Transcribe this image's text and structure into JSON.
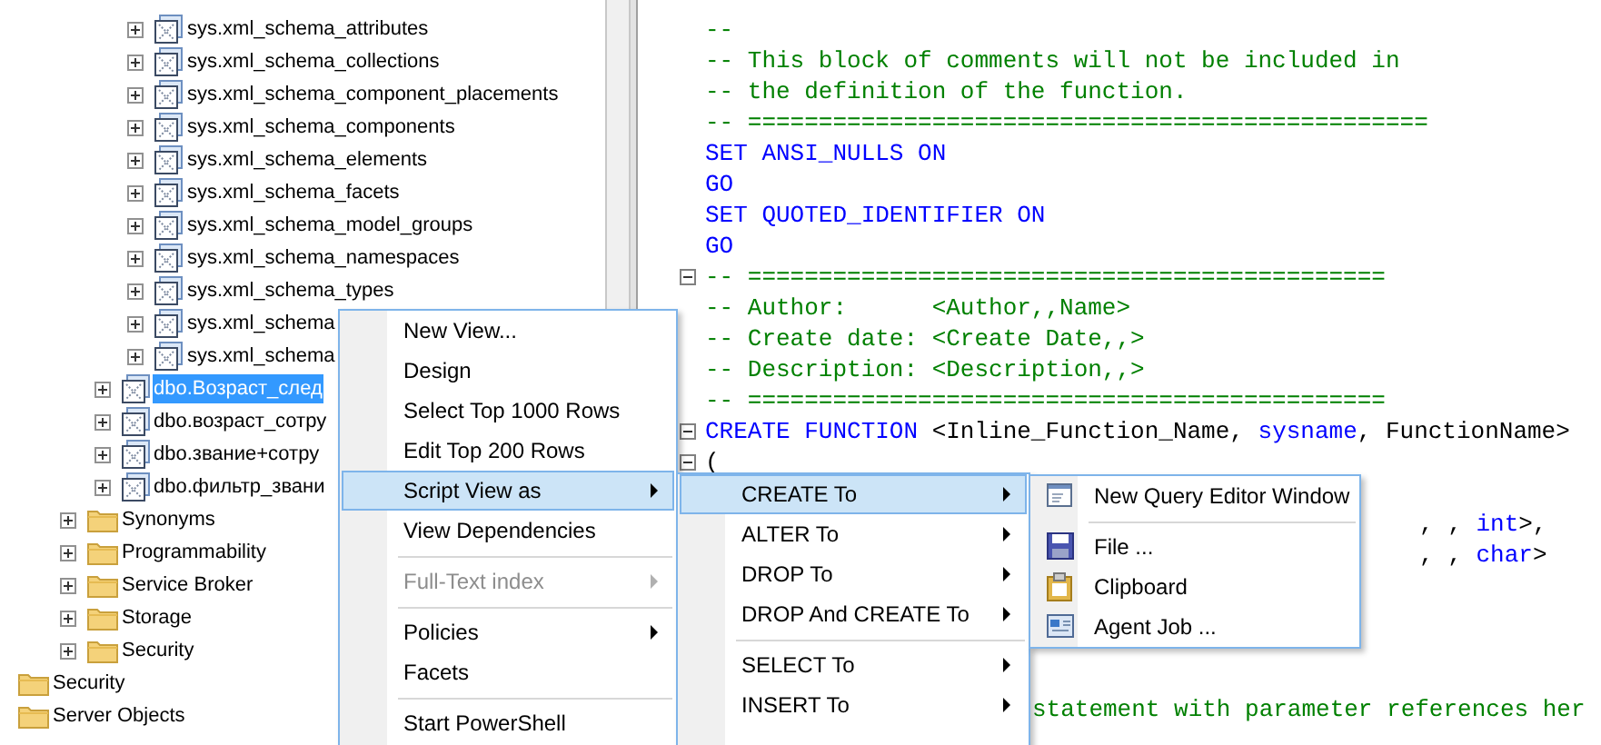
{
  "tree": [
    {
      "children": [
        {
          "children": [
            {
              "children": [
                {
                  "label": "sys.xml_schema_attributes",
                  "kind": "view",
                  "expander": true,
                  "selected": false
                },
                {
                  "label": "sys.xml_schema_collections",
                  "kind": "view",
                  "expander": true,
                  "selected": false
                },
                {
                  "label": "sys.xml_schema_component_placements",
                  "kind": "view",
                  "expander": true,
                  "selected": false
                },
                {
                  "label": "sys.xml_schema_components",
                  "kind": "view",
                  "expander": true,
                  "selected": false
                },
                {
                  "label": "sys.xml_schema_elements",
                  "kind": "view",
                  "expander": true,
                  "selected": false
                },
                {
                  "label": "sys.xml_schema_facets",
                  "kind": "view",
                  "expander": true,
                  "selected": false
                },
                {
                  "label": "sys.xml_schema_model_groups",
                  "kind": "view",
                  "expander": true,
                  "selected": false
                },
                {
                  "label": "sys.xml_schema_namespaces",
                  "kind": "view",
                  "expander": true,
                  "selected": false
                },
                {
                  "label": "sys.xml_schema_types",
                  "kind": "view",
                  "expander": true,
                  "selected": false
                },
                {
                  "label": "sys.xml_schema",
                  "kind": "view",
                  "expander": true,
                  "selected": false
                },
                {
                  "label": "sys.xml_schema",
                  "kind": "view",
                  "expander": true,
                  "selected": false
                }
              ]
            },
            {
              "label": "dbo.Возраст_след",
              "kind": "view",
              "expander": true,
              "selected": true
            },
            {
              "label": "dbo.возраст_сотру",
              "kind": "view",
              "expander": true,
              "selected": false
            },
            {
              "label": "dbo.звание+сотру",
              "kind": "view",
              "expander": true,
              "selected": false
            },
            {
              "label": "dbo.фильтр_звани",
              "kind": "view",
              "expander": true,
              "selected": false
            }
          ]
        },
        {
          "label": "Synonyms",
          "kind": "folder",
          "expander": true,
          "selected": false
        },
        {
          "label": "Programmability",
          "kind": "folder",
          "expander": true,
          "selected": false
        },
        {
          "label": "Service Broker",
          "kind": "folder",
          "expander": true,
          "selected": false
        },
        {
          "label": "Storage",
          "kind": "folder",
          "expander": true,
          "selected": false
        },
        {
          "label": "Security",
          "kind": "folder",
          "expander": true,
          "selected": false
        }
      ]
    },
    {
      "label": "Security",
      "kind": "folder",
      "expander": false,
      "selected": false
    },
    {
      "label": "Server Objects",
      "kind": "folder",
      "expander": false,
      "selected": false
    }
  ],
  "code": [
    {
      "kind": "code",
      "collapsible": false,
      "segments": [
        {
          "kind": "comment",
          "text": "--"
        }
      ]
    },
    {
      "kind": "code",
      "collapsible": false,
      "segments": [
        {
          "kind": "comment",
          "text": "-- This block of comments will not be included in"
        }
      ]
    },
    {
      "kind": "code",
      "collapsible": false,
      "segments": [
        {
          "kind": "comment",
          "text": "-- the definition of the function."
        }
      ]
    },
    {
      "kind": "code",
      "collapsible": false,
      "segments": [
        {
          "kind": "comment",
          "text": "-- ================================================"
        }
      ]
    },
    {
      "kind": "code",
      "collapsible": false,
      "segments": [
        {
          "kind": "keyword",
          "text": "SET ANSI_NULLS ON"
        }
      ]
    },
    {
      "kind": "code",
      "collapsible": false,
      "segments": [
        {
          "kind": "keyword",
          "text": "GO"
        }
      ]
    },
    {
      "kind": "code",
      "collapsible": false,
      "segments": [
        {
          "kind": "keyword",
          "text": "SET QUOTED_IDENTIFIER ON"
        }
      ]
    },
    {
      "kind": "code",
      "collapsible": false,
      "segments": [
        {
          "kind": "keyword",
          "text": "GO"
        }
      ]
    },
    {
      "kind": "code",
      "collapsible": true,
      "segments": [
        {
          "kind": "comment",
          "text": "-- ============================================="
        }
      ]
    },
    {
      "kind": "code",
      "collapsible": false,
      "segments": [
        {
          "kind": "comment",
          "text": "-- Author:      <Author,,Name>"
        }
      ]
    },
    {
      "kind": "code",
      "collapsible": false,
      "segments": [
        {
          "kind": "comment",
          "text": "-- Create date: <Create Date,,>"
        }
      ]
    },
    {
      "kind": "code",
      "collapsible": false,
      "segments": [
        {
          "kind": "comment",
          "text": "-- Description: <Description,,>"
        }
      ]
    },
    {
      "kind": "code",
      "collapsible": false,
      "segments": [
        {
          "kind": "comment",
          "text": "-- ============================================="
        }
      ]
    },
    {
      "kind": "code",
      "collapsible": true,
      "segments": [
        {
          "kind": "keyword",
          "text": "CREATE FUNCTION "
        },
        {
          "kind": "plain",
          "text": "<Inline_Function_Name, "
        },
        {
          "kind": "keyword",
          "text": "sysname"
        },
        {
          "kind": "plain",
          "text": ", FunctionName>"
        }
      ]
    },
    {
      "kind": "code",
      "collapsible": true,
      "segments": [
        {
          "kind": "plain",
          "text": "("
        }
      ]
    },
    {
      "kind": "blank"
    },
    {
      "kind": "tail",
      "collapsible": false,
      "segments": [
        {
          "kind": "plain",
          "text": ", , "
        },
        {
          "kind": "keyword",
          "text": "int"
        },
        {
          "kind": "plain",
          "text": ">,"
        }
      ]
    },
    {
      "kind": "tail",
      "collapsible": false,
      "segments": [
        {
          "kind": "plain",
          "text": ", , "
        },
        {
          "kind": "keyword",
          "text": "char"
        },
        {
          "kind": "plain",
          "text": ">"
        }
      ]
    },
    {
      "kind": "blank"
    },
    {
      "kind": "blank"
    },
    {
      "kind": "blank"
    },
    {
      "kind": "blank"
    },
    {
      "kind": "after_menu",
      "collapsible": false,
      "segments": [
        {
          "kind": "comment",
          "text": "statement with parameter references her"
        }
      ]
    }
  ],
  "context_menu": {
    "items": [
      {
        "kind": "item",
        "label": "New View...",
        "selected": false,
        "disabled": false,
        "submenu": false
      },
      {
        "kind": "item",
        "label": "Design",
        "selected": false,
        "disabled": false,
        "submenu": false
      },
      {
        "kind": "item",
        "label": "Select Top 1000 Rows",
        "selected": false,
        "disabled": false,
        "submenu": false
      },
      {
        "kind": "item",
        "label": "Edit Top 200 Rows",
        "selected": false,
        "disabled": false,
        "submenu": false
      },
      {
        "kind": "item",
        "label": "Script View as",
        "selected": true,
        "disabled": false,
        "submenu": true
      },
      {
        "kind": "item",
        "label": "View Dependencies",
        "selected": false,
        "disabled": false,
        "submenu": false
      },
      {
        "kind": "separator"
      },
      {
        "kind": "item",
        "label": "Full-Text index",
        "selected": false,
        "disabled": true,
        "submenu": true
      },
      {
        "kind": "separator"
      },
      {
        "kind": "item",
        "label": "Policies",
        "selected": false,
        "disabled": false,
        "submenu": true
      },
      {
        "kind": "item",
        "label": "Facets",
        "selected": false,
        "disabled": false,
        "submenu": false
      },
      {
        "kind": "separator"
      },
      {
        "kind": "item",
        "label": "Start PowerShell",
        "selected": false,
        "disabled": false,
        "submenu": false
      }
    ]
  },
  "script_submenu": {
    "items": [
      {
        "kind": "item",
        "label": "CREATE To",
        "selected": true,
        "disabled": false,
        "submenu": true
      },
      {
        "kind": "item",
        "label": "ALTER To",
        "selected": false,
        "disabled": false,
        "submenu": true
      },
      {
        "kind": "item",
        "label": "DROP To",
        "selected": false,
        "disabled": false,
        "submenu": true
      },
      {
        "kind": "item",
        "label": "DROP And CREATE To",
        "selected": false,
        "disabled": false,
        "submenu": true
      },
      {
        "kind": "separator"
      },
      {
        "kind": "item",
        "label": "SELECT To",
        "selected": false,
        "disabled": false,
        "submenu": true
      },
      {
        "kind": "item",
        "label": "INSERT To",
        "selected": false,
        "disabled": false,
        "submenu": true
      }
    ]
  },
  "create_submenu": {
    "items": [
      {
        "kind": "item",
        "label": "New Query Editor Window"
      },
      {
        "kind": "separator"
      },
      {
        "kind": "item",
        "label": "File ..."
      },
      {
        "kind": "item",
        "label": "Clipboard"
      },
      {
        "kind": "item",
        "label": "Agent Job ..."
      }
    ]
  }
}
